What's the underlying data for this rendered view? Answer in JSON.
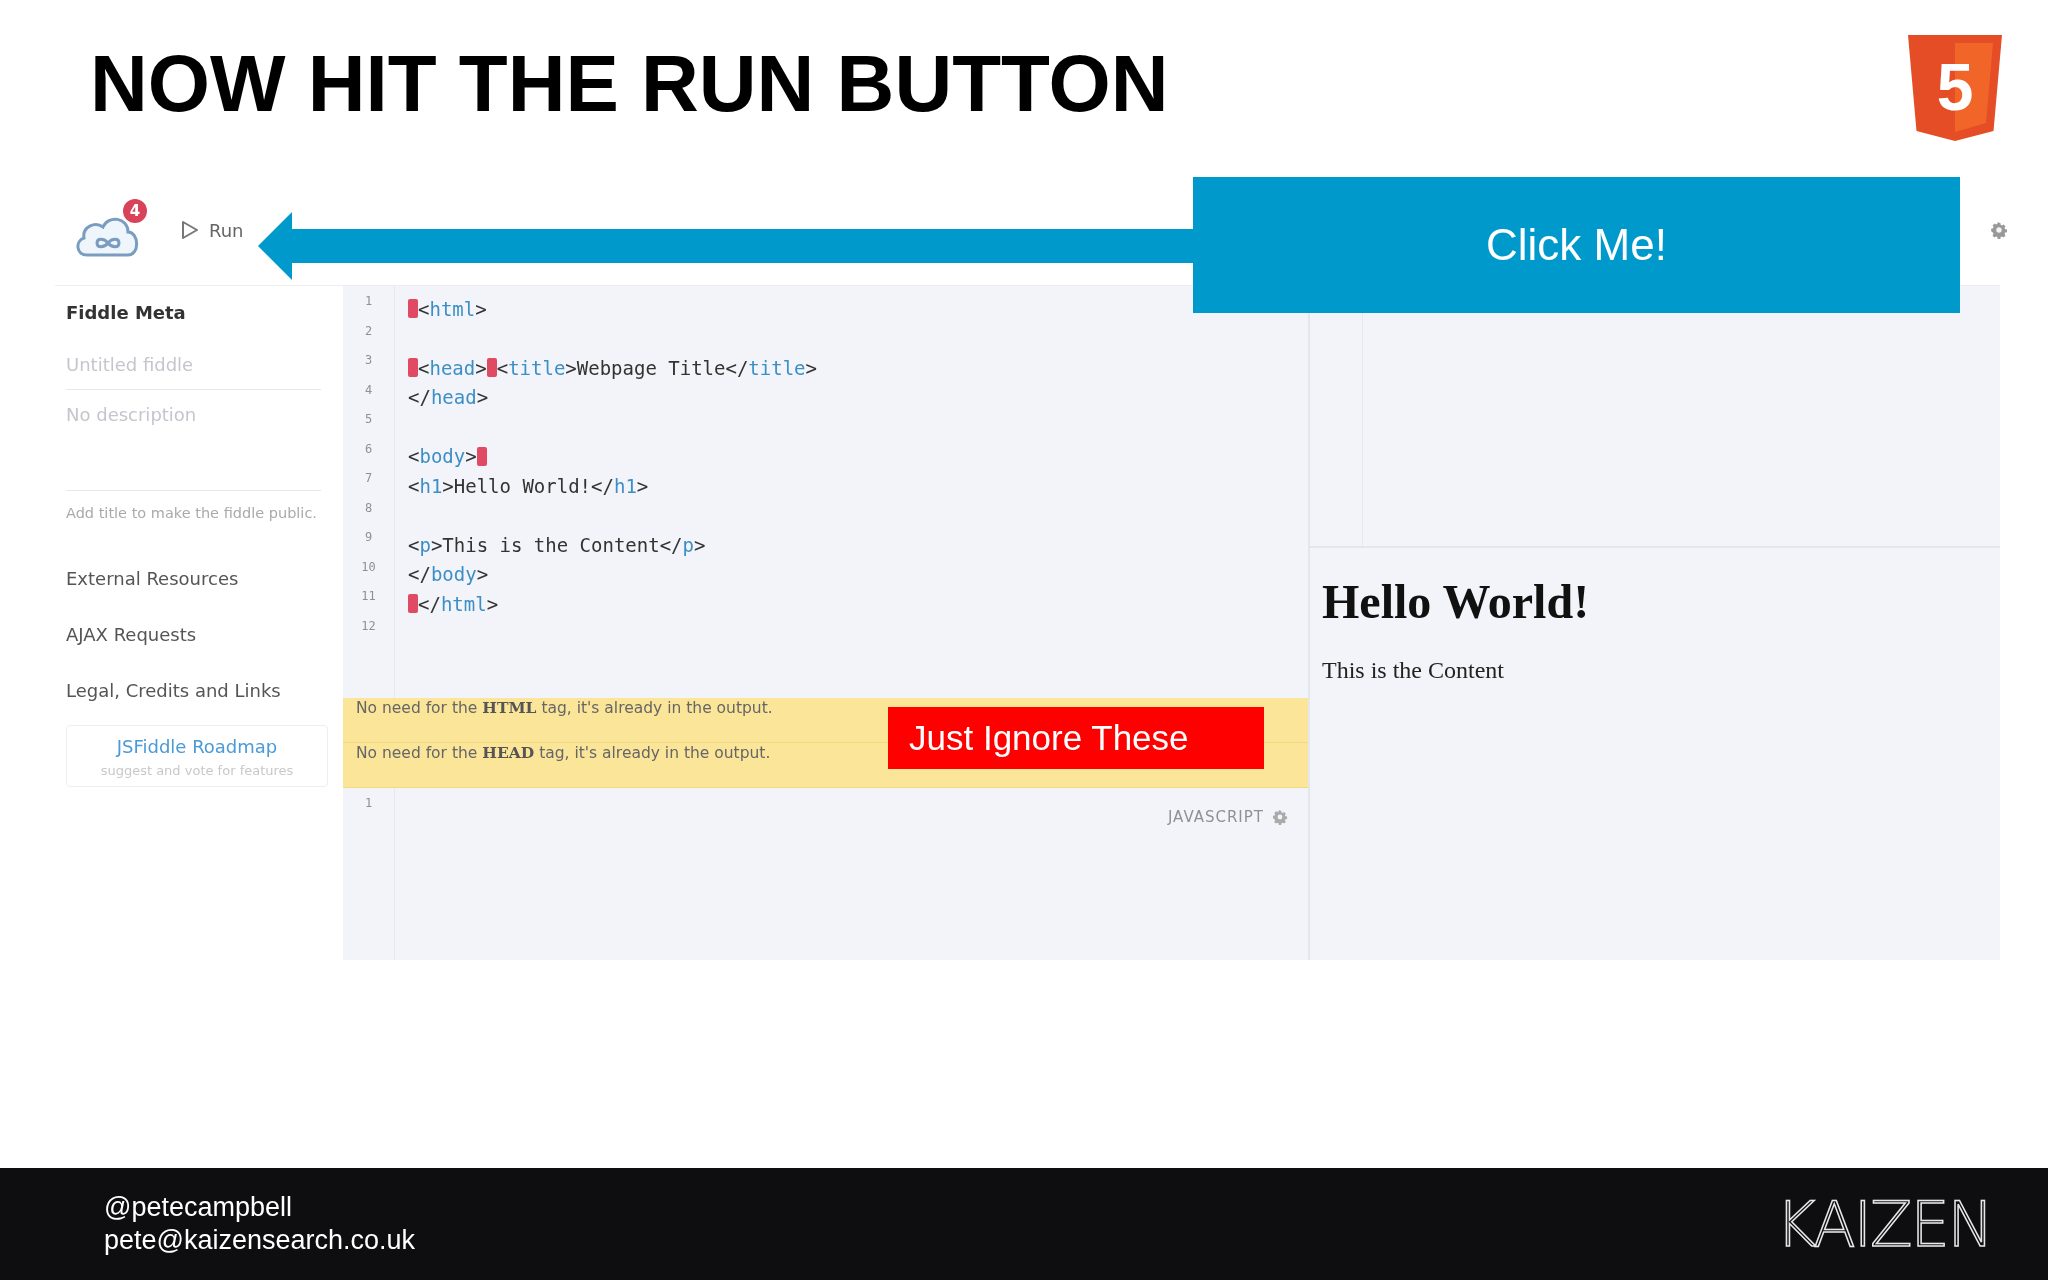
{
  "slide_title": "NOW HIT THE RUN BUTTON",
  "logo_mark": "5",
  "toolbar": {
    "badge": "4",
    "run_label": "Run"
  },
  "sidebar": {
    "heading": "Fiddle Meta",
    "title_field": {
      "placeholder": "Untitled fiddle"
    },
    "description_field": {
      "placeholder": "No description"
    },
    "note": "Add title to make the fiddle public.",
    "sections": [
      "External Resources",
      "AJAX Requests",
      "Legal, Credits and Links"
    ],
    "roadmap": {
      "title": "JSFiddle Roadmap",
      "subtitle": "suggest and vote for features"
    }
  },
  "html_panel": {
    "lines": [
      {
        "number": "1",
        "tokens": [
          {
            "kind": "mark"
          },
          {
            "kind": "text",
            "text": "<"
          },
          {
            "kind": "tag",
            "text": "html"
          },
          {
            "kind": "text",
            "text": ">"
          }
        ]
      },
      {
        "number": "2"
      },
      {
        "number": "3",
        "tokens": [
          {
            "kind": "mark"
          },
          {
            "kind": "text",
            "text": "<"
          },
          {
            "kind": "tag",
            "text": "head"
          },
          {
            "kind": "text",
            "text": ">"
          },
          {
            "kind": "mark"
          },
          {
            "kind": "text",
            "text": "<"
          },
          {
            "kind": "tag",
            "text": "title"
          },
          {
            "kind": "text",
            "text": ">Webpage Title</"
          },
          {
            "kind": "tag",
            "text": "title"
          },
          {
            "kind": "text",
            "text": ">"
          }
        ]
      },
      {
        "number": "4",
        "tokens": [
          {
            "kind": "text",
            "text": "</"
          },
          {
            "kind": "tag",
            "text": "head"
          },
          {
            "kind": "text",
            "text": ">"
          }
        ]
      },
      {
        "number": "5"
      },
      {
        "number": "6",
        "tokens": [
          {
            "kind": "text",
            "text": "<"
          },
          {
            "kind": "tag",
            "text": "body"
          },
          {
            "kind": "text",
            "text": ">"
          },
          {
            "kind": "mark"
          }
        ]
      },
      {
        "number": "7",
        "tokens": [
          {
            "kind": "text",
            "text": "<"
          },
          {
            "kind": "tag",
            "text": "h1"
          },
          {
            "kind": "text",
            "text": ">Hello World!</"
          },
          {
            "kind": "tag",
            "text": "h1"
          },
          {
            "kind": "text",
            "text": ">"
          }
        ]
      },
      {
        "number": "8"
      },
      {
        "number": "9",
        "tokens": [
          {
            "kind": "text",
            "text": "<"
          },
          {
            "kind": "tag",
            "text": "p"
          },
          {
            "kind": "text",
            "text": ">This is the Content</"
          },
          {
            "kind": "tag",
            "text": "p"
          },
          {
            "kind": "text",
            "text": ">"
          }
        ]
      },
      {
        "number": "10",
        "tokens": [
          {
            "kind": "text",
            "text": "</"
          },
          {
            "kind": "tag",
            "text": "body"
          },
          {
            "kind": "text",
            "text": ">"
          }
        ]
      },
      {
        "number": "11",
        "tokens": [
          {
            "kind": "mark"
          },
          {
            "kind": "text",
            "text": "</"
          },
          {
            "kind": "tag",
            "text": "html"
          },
          {
            "kind": "text",
            "text": ">"
          }
        ]
      },
      {
        "number": "12"
      }
    ]
  },
  "warnings": [
    "No need for the **HTML** tag, it's already in the output.",
    "No need for the **HEAD** tag, it's already in the output."
  ],
  "js_panel": {
    "label": "JAVASCRIPT",
    "lines": [
      {
        "number": "1"
      }
    ]
  },
  "result": {
    "heading": "Hello World!",
    "paragraph": "This is the Content"
  },
  "annotations": [
    {
      "kind": "callout",
      "text": "Click Me!"
    },
    {
      "kind": "label",
      "text": "Just Ignore These"
    }
  ],
  "footer": {
    "lines": [
      "@petecampbell",
      "pete@kaizensearch.co.uk"
    ],
    "brand": "KAIZEN"
  }
}
